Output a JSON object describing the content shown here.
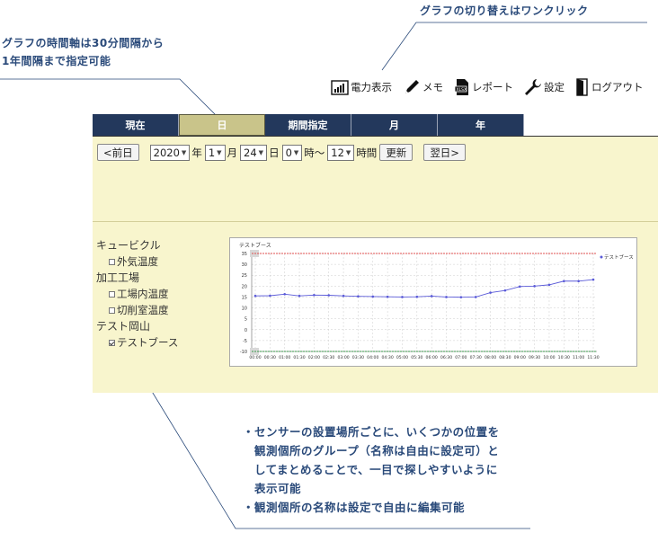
{
  "callouts": {
    "top": "グラフの切り替えはワンクリック",
    "left_line1": "グラフの時間軸は30分間隔から",
    "left_line2": "1年間隔まで指定可能",
    "bottom_lines": [
      "・センサーの設置場所ごとに、いくつかの位置を",
      "　観測個所のグループ（名称は自由に設定可）と",
      "　してまとめることで、一目で探しやすいように",
      "　表示可能",
      "・観測個所の名称は設定で自由に編集可能"
    ]
  },
  "toolbar": {
    "power_label": "電力表示",
    "memo_label": "メモ",
    "report_label": "レポート",
    "settings_label": "設定",
    "logout_label": "ログアウト"
  },
  "tabs": [
    {
      "label": "現在",
      "active": false
    },
    {
      "label": "日",
      "active": true
    },
    {
      "label": "期間指定",
      "active": false
    },
    {
      "label": "月",
      "active": false
    },
    {
      "label": "年",
      "active": false
    }
  ],
  "controls": {
    "prev_button": "<前日",
    "year_value": "2020",
    "year_unit": "年",
    "month_value": "1",
    "month_unit": "月",
    "day_value": "24",
    "day_unit": "日",
    "hour_start_value": "0",
    "hour_start_unit": "時～",
    "hour_count_value": "12",
    "hour_count_unit": "時間",
    "update_button": "更新",
    "next_button": "翌日>"
  },
  "tree": {
    "groups": [
      {
        "name": "キュービクル",
        "items": [
          {
            "name": "外気温度",
            "checked": false
          }
        ]
      },
      {
        "name": "加工工場",
        "items": [
          {
            "name": "工場内温度",
            "checked": false
          },
          {
            "name": "切削室温度",
            "checked": false
          }
        ]
      },
      {
        "name": "テスト岡山",
        "items": [
          {
            "name": "テストブース",
            "checked": true
          }
        ]
      }
    ]
  },
  "colors": {
    "tab_bg": "#23385c",
    "tab_active_bg": "#c9c48a",
    "panel_bg": "#f8f5cd",
    "callout_text": "#2a4a7a",
    "series_line": "#5a5ad8",
    "threshold_line": "#e05050"
  },
  "chart_data": {
    "type": "line",
    "title": "テストブース",
    "x": [
      "00:00",
      "00:30",
      "01:00",
      "01:30",
      "02:00",
      "02:30",
      "03:00",
      "03:30",
      "04:00",
      "04:30",
      "05:00",
      "05:30",
      "06:00",
      "06:30",
      "07:00",
      "07:30",
      "08:00",
      "08:30",
      "09:00",
      "09:30",
      "10:00",
      "10:30",
      "11:00",
      "11:30"
    ],
    "series": [
      {
        "name": "テストブース",
        "values": [
          15.5,
          15.6,
          16.3,
          15.5,
          15.9,
          15.8,
          15.5,
          15.3,
          15.2,
          15.1,
          15.0,
          15.1,
          15.4,
          15.0,
          14.9,
          15.0,
          17.0,
          18.0,
          19.8,
          20.0,
          20.6,
          22.3,
          22.3,
          23.0
        ]
      }
    ],
    "upper_threshold": 35,
    "lower_threshold": -10,
    "yticks": [
      35,
      30,
      25,
      20,
      15,
      10,
      5,
      0,
      -5,
      -10
    ],
    "ylim": [
      -10,
      35
    ],
    "grid": true,
    "legend": "right"
  }
}
